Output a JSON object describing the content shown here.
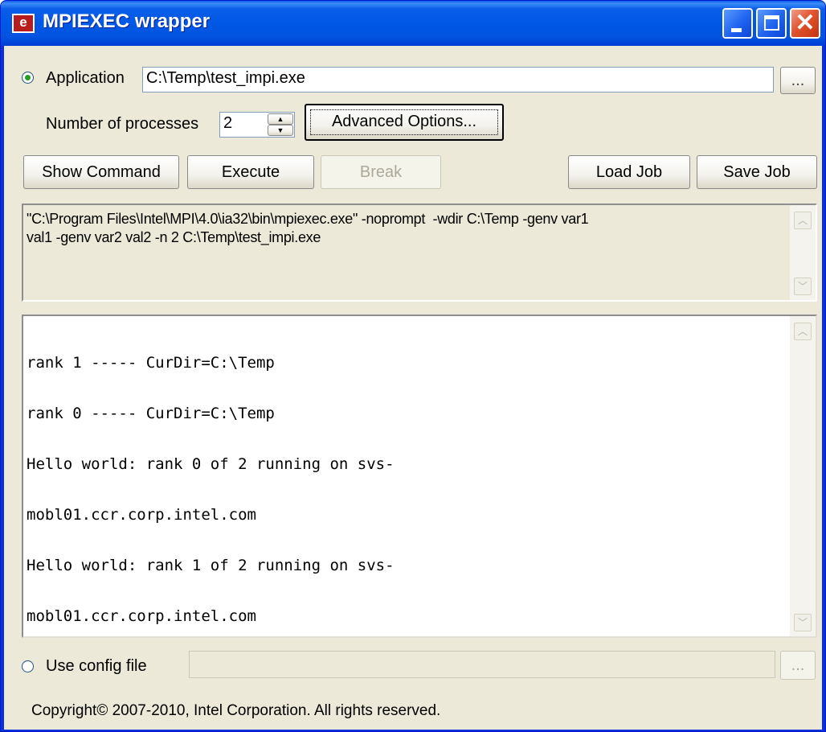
{
  "window": {
    "title": "MPIEXEC wrapper",
    "app_icon": "e"
  },
  "application": {
    "radio_label": "Application",
    "radio_selected": true,
    "path": "C:\\Temp\\test_impi.exe",
    "browse_label": "..."
  },
  "processes": {
    "label": "Number of processes",
    "value": "2",
    "advanced_label": "Advanced Options..."
  },
  "buttons": {
    "show_command": "Show Command",
    "execute": "Execute",
    "break": "Break",
    "load_job": "Load Job",
    "save_job": "Save Job"
  },
  "command_text": "\"C:\\Program Files\\Intel\\MPI\\4.0\\ia32\\bin\\mpiexec.exe\" -noprompt  -wdir C:\\Temp -genv var1\nval1 -genv var2 val2 -n 2 C:\\Temp\\test_impi.exe",
  "output_lines": [
    "rank 1 ----- CurDir=C:\\Temp",
    "rank 0 ----- CurDir=C:\\Temp",
    "Hello world: rank 0 of 2 running on svs-",
    "mobl01.ccr.corp.intel.com",
    "Hello world: rank 1 of 2 running on svs-",
    "mobl01.ccr.corp.intel.com"
  ],
  "config": {
    "radio_label": "Use config file",
    "radio_selected": false,
    "path": "",
    "browse_label": "..."
  },
  "copyright": "Copyright© 2007-2010, Intel Corporation. All rights reserved."
}
